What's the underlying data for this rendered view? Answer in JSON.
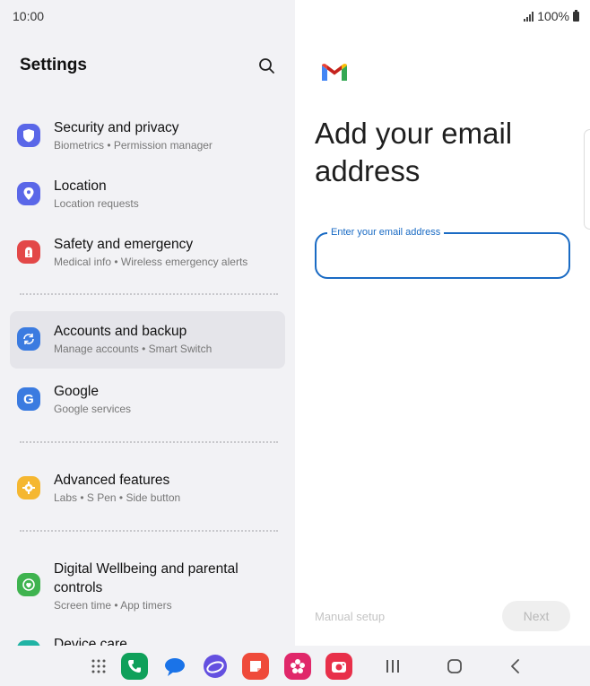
{
  "status": {
    "time": "10:00",
    "battery": "100%"
  },
  "settings": {
    "title": "Settings",
    "items": [
      {
        "title": "Security and privacy",
        "subtitle": "Biometrics  •  Permission manager",
        "icon": "shield-icon",
        "color": "#5a67e8"
      },
      {
        "title": "Location",
        "subtitle": "Location requests",
        "icon": "location-pin-icon",
        "color": "#5a67e8"
      },
      {
        "title": "Safety and emergency",
        "subtitle": "Medical info  •  Wireless emergency alerts",
        "icon": "emergency-icon",
        "color": "#e34848"
      },
      {
        "title": "Accounts and backup",
        "subtitle": "Manage accounts  •  Smart Switch",
        "icon": "sync-icon",
        "color": "#3b7be0"
      },
      {
        "title": "Google",
        "subtitle": "Google services",
        "icon": "google-icon",
        "color": "#3b7be0"
      },
      {
        "title": "Advanced features",
        "subtitle": "Labs  •  S Pen  •  Side button",
        "icon": "gear-star-icon",
        "color": "#f5b731"
      },
      {
        "title": "Digital Wellbeing and parental controls",
        "subtitle": "Screen time  •  App timers",
        "icon": "wellbeing-icon",
        "color": "#3fb34f"
      },
      {
        "title": "Device care",
        "subtitle": "",
        "icon": "device-care-icon",
        "color": "#20b3a4"
      }
    ]
  },
  "gmail": {
    "heading": "Add your email address",
    "email_label": "Enter your email address",
    "email_value": "",
    "manual_setup": "Manual setup",
    "next": "Next"
  },
  "navbar": {
    "apps": [
      {
        "icon": "apps-grid-icon"
      },
      {
        "icon": "phone-app-icon",
        "color": "#0fa05a"
      },
      {
        "icon": "messages-app-icon",
        "color": "#1a73e8"
      },
      {
        "icon": "internet-app-icon",
        "color": "#6450e0"
      },
      {
        "icon": "notes-app-icon",
        "color": "#ef4a3a"
      },
      {
        "icon": "gallery-app-icon",
        "color": "#e0286a"
      },
      {
        "icon": "camera-app-icon",
        "color": "#e8304a"
      }
    ]
  }
}
